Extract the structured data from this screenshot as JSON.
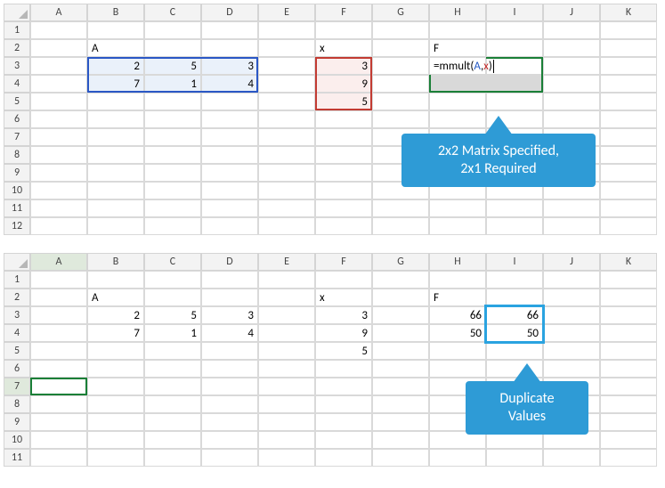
{
  "columns": [
    "A",
    "B",
    "C",
    "D",
    "E",
    "F",
    "G",
    "H",
    "I",
    "J",
    "K"
  ],
  "top": {
    "rows": [
      "1",
      "2",
      "3",
      "4",
      "5",
      "6",
      "7",
      "8",
      "9",
      "10",
      "11",
      "12"
    ],
    "labels": {
      "A": "A",
      "x": "x",
      "F": "F"
    },
    "matrixA": [
      [
        "2",
        "5",
        "3"
      ],
      [
        "7",
        "1",
        "4"
      ]
    ],
    "vectorX": [
      "3",
      "9",
      "5"
    ],
    "formula": {
      "prefix": "=mmult(",
      "argA": "A",
      "comma": ",",
      "argX": "x",
      "suffix": ")"
    },
    "callout": {
      "line1": "2x2 Matrix Specified,",
      "line2": "2x1 Required"
    }
  },
  "bottom": {
    "rows": [
      "1",
      "2",
      "3",
      "4",
      "5",
      "6",
      "7",
      "8",
      "9",
      "10",
      "11"
    ],
    "labels": {
      "A": "A",
      "x": "x",
      "F": "F"
    },
    "matrixA": [
      [
        "2",
        "5",
        "3"
      ],
      [
        "7",
        "1",
        "4"
      ]
    ],
    "vectorX": [
      "3",
      "9",
      "5"
    ],
    "resultH": [
      "66",
      "50"
    ],
    "resultI": [
      "66",
      "50"
    ],
    "callout": {
      "line1": "Duplicate",
      "line2": "Values"
    }
  },
  "colors": {
    "blueBorder": "#2a57c5",
    "redBorder": "#c23b32",
    "greenBorder": "#1a7f37",
    "calloutBlue": "#2e9bd6",
    "dupBorder": "#2aa3e0"
  }
}
